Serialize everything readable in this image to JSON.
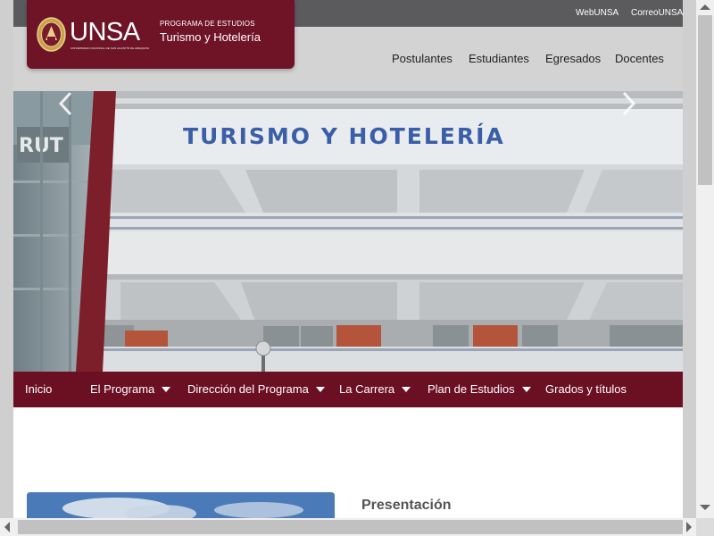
{
  "topbar": {
    "links": [
      "WebUNSA",
      "CorreoUNSA"
    ],
    "background": "#5b5b5d"
  },
  "logo": {
    "brand": "UNSA",
    "university_line": "UNIVERSIDAD NACIONAL DE SAN AGUSTÍN DE AREQUIPA",
    "program_label": "PROGRAMA DE ESTUDIOS",
    "program_name": "Turismo y Hotelería",
    "background": "#6e1426"
  },
  "header": {
    "nav": [
      "Postulantes",
      "Estudiantes",
      "Egresados",
      "Docentes"
    ]
  },
  "hero": {
    "building_sign": "TURISMO  Y  HOTELERÍA",
    "slides": 4,
    "active_slide": 1
  },
  "menu": {
    "background": "#6b0f23",
    "items": [
      {
        "label": "Inicio",
        "dropdown": false
      },
      {
        "label": "El Programa",
        "dropdown": true
      },
      {
        "label": "Dirección del Programa",
        "dropdown": true
      },
      {
        "label": "La Carrera",
        "dropdown": true
      },
      {
        "label": "Plan de Estudios",
        "dropdown": true
      },
      {
        "label": "Grados y títulos",
        "dropdown": false
      }
    ]
  },
  "content": {
    "section_title": "Presentación"
  }
}
